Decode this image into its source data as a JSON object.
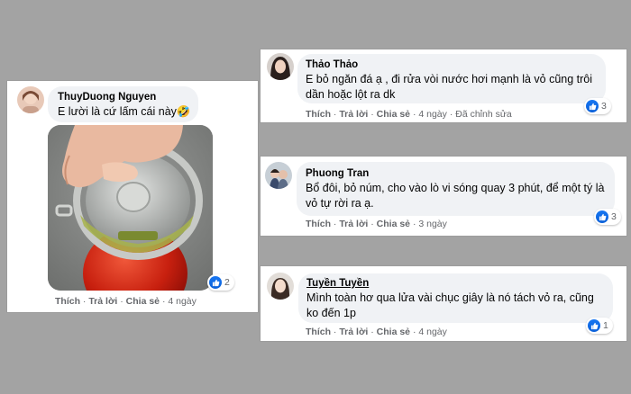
{
  "colors": {
    "background": "#a3a3a3",
    "bubble": "#f0f2f5",
    "like_blue": "#1877f2",
    "meta_text": "#65676b"
  },
  "comments": [
    {
      "name": "ThuyDuong Nguyen",
      "text": "E lười là cứ lấm cái này🤣",
      "reactions": "2",
      "actions": {
        "like": "Thích",
        "reply": "Trả lời",
        "share": "Chia sẻ",
        "time": "4 ngày",
        "edited": ""
      }
    },
    {
      "name": "Thảo Thảo",
      "text": "E bỏ ngăn đá ạ , đi rửa vòi nước hơi mạnh là vỏ cũng trôi dần hoặc lột ra dk",
      "reactions": "3",
      "actions": {
        "like": "Thích",
        "reply": "Trả lời",
        "share": "Chia sẻ",
        "time": "4 ngày",
        "edited": "Đã chỉnh sửa"
      }
    },
    {
      "name": "Phuong Tran",
      "text": "Bổ đôi, bỏ núm, cho vào lò vi sóng quay 3 phút, để một tý là vỏ tự rời ra ạ.",
      "reactions": "3",
      "actions": {
        "like": "Thích",
        "reply": "Trả lời",
        "share": "Chia sẻ",
        "time": "3 ngày",
        "edited": ""
      }
    },
    {
      "name": "Tuyền Tuyền",
      "text": "Mình toàn hơ qua lửa vài chục giây là nó tách vỏ ra, cũng ko đến 1p",
      "reactions": "1",
      "actions": {
        "like": "Thích",
        "reply": "Trả lời",
        "share": "Chia sẻ",
        "time": "4 ngày",
        "edited": ""
      }
    }
  ]
}
